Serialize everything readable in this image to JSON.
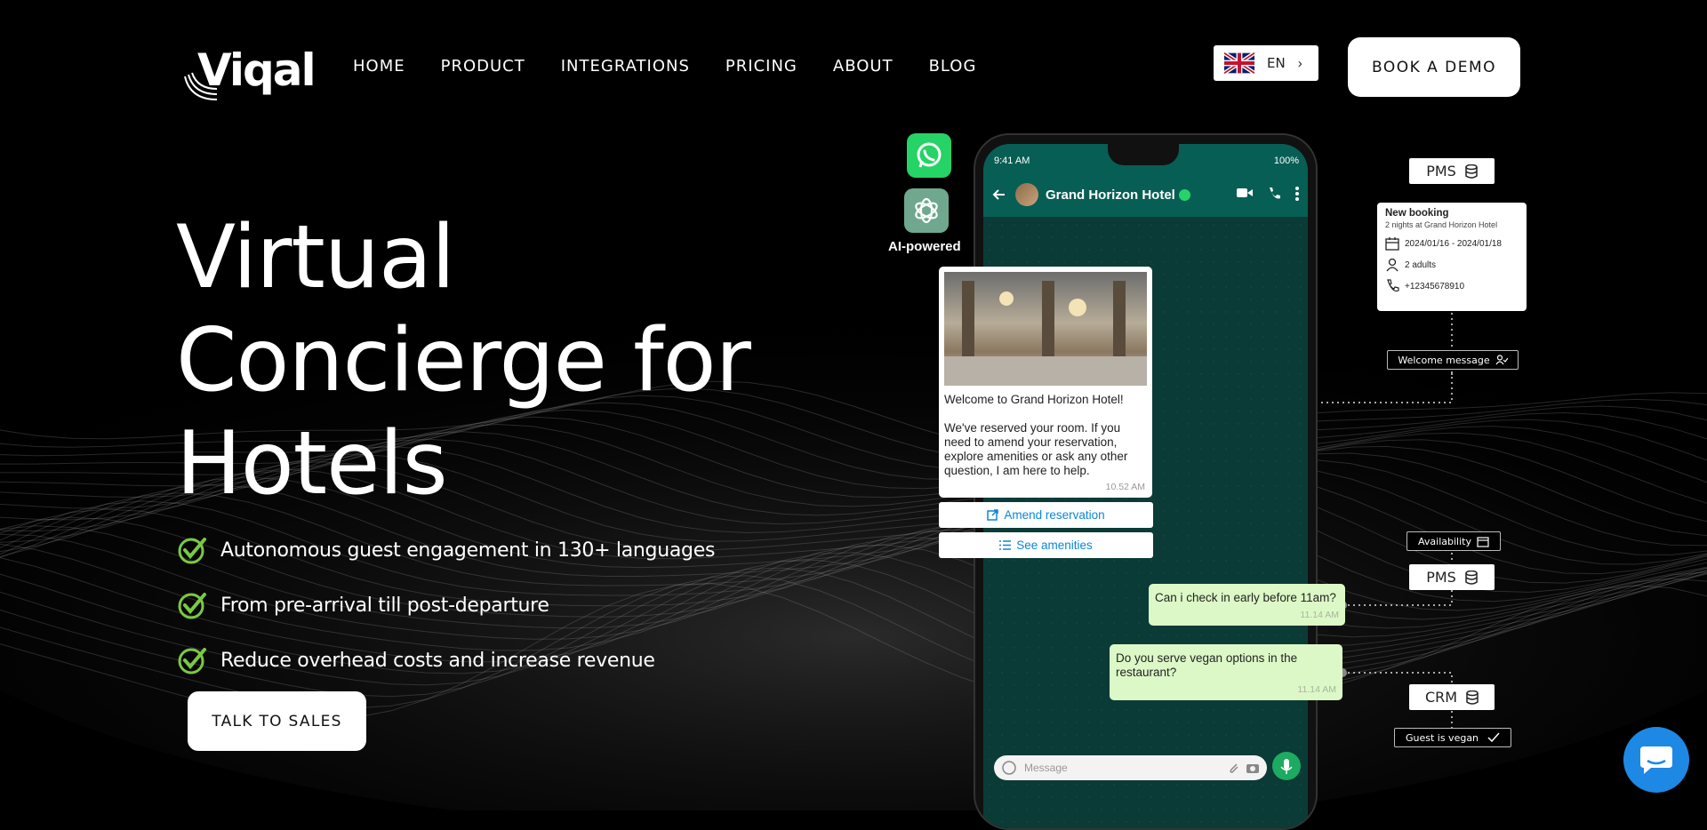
{
  "brand": {
    "logo_text": "Viqal"
  },
  "nav": {
    "items": [
      {
        "label": "HOME"
      },
      {
        "label": "PRODUCT"
      },
      {
        "label": "INTEGRATIONS"
      },
      {
        "label": "PRICING"
      },
      {
        "label": "ABOUT"
      },
      {
        "label": "BLOG"
      }
    ]
  },
  "lang": {
    "label": "EN",
    "flag_icon": "uk-flag-icon"
  },
  "header": {
    "demo_label": "BOOK A DEMO"
  },
  "hero": {
    "title_lines": [
      "Virtual",
      "Concierge for",
      "Hotels"
    ],
    "bullets": [
      "Autonomous guest engagement in 130+ languages",
      "From pre-arrival till post-departure",
      "Reduce overhead costs and increase revenue"
    ],
    "cta_label": "TALK TO SALES",
    "check_color": "#7ac943"
  },
  "side_apps": {
    "ai_label": "AI-powered"
  },
  "phone": {
    "status_time": "9:41 AM",
    "status_battery": "100%",
    "contact_name": "Grand Horizon Hotel",
    "message_placeholder": "Message",
    "welcome": {
      "line1": "Welcome to Grand Horizon Hotel!",
      "body": "We've reserved your room. If you need to amend your reservation, explore amenities or ask any other question, I am here to help.",
      "time": "10.52 AM"
    },
    "actions": [
      {
        "label": "Amend reservation"
      },
      {
        "label": "See amenities"
      }
    ],
    "outgoing": [
      {
        "text": "Can i check in early before 11am?",
        "time": "11.14 AM"
      },
      {
        "text": "Do you serve vegan options in the restaurant?",
        "time": "11.14 AM"
      }
    ]
  },
  "annotations": {
    "pms_top": "PMS",
    "booking": {
      "title": "New booking",
      "subtitle": "2 nights at Grand Horizon Hotel",
      "dates": "2024/01/16 - 2024/01/18",
      "guests": "2 adults",
      "phone": "+12345678910"
    },
    "welcome_message": "Welcome message",
    "availability": "Availability",
    "pms_mid": "PMS",
    "crm": "CRM",
    "guest_vegan": "Guest is vegan"
  },
  "colors": {
    "whatsapp_green": "#25d366",
    "chat_header": "#075e54",
    "out_bubble": "#dcf8c6",
    "link_blue": "#0a86d8",
    "widget_blue": "#1e88e5"
  }
}
